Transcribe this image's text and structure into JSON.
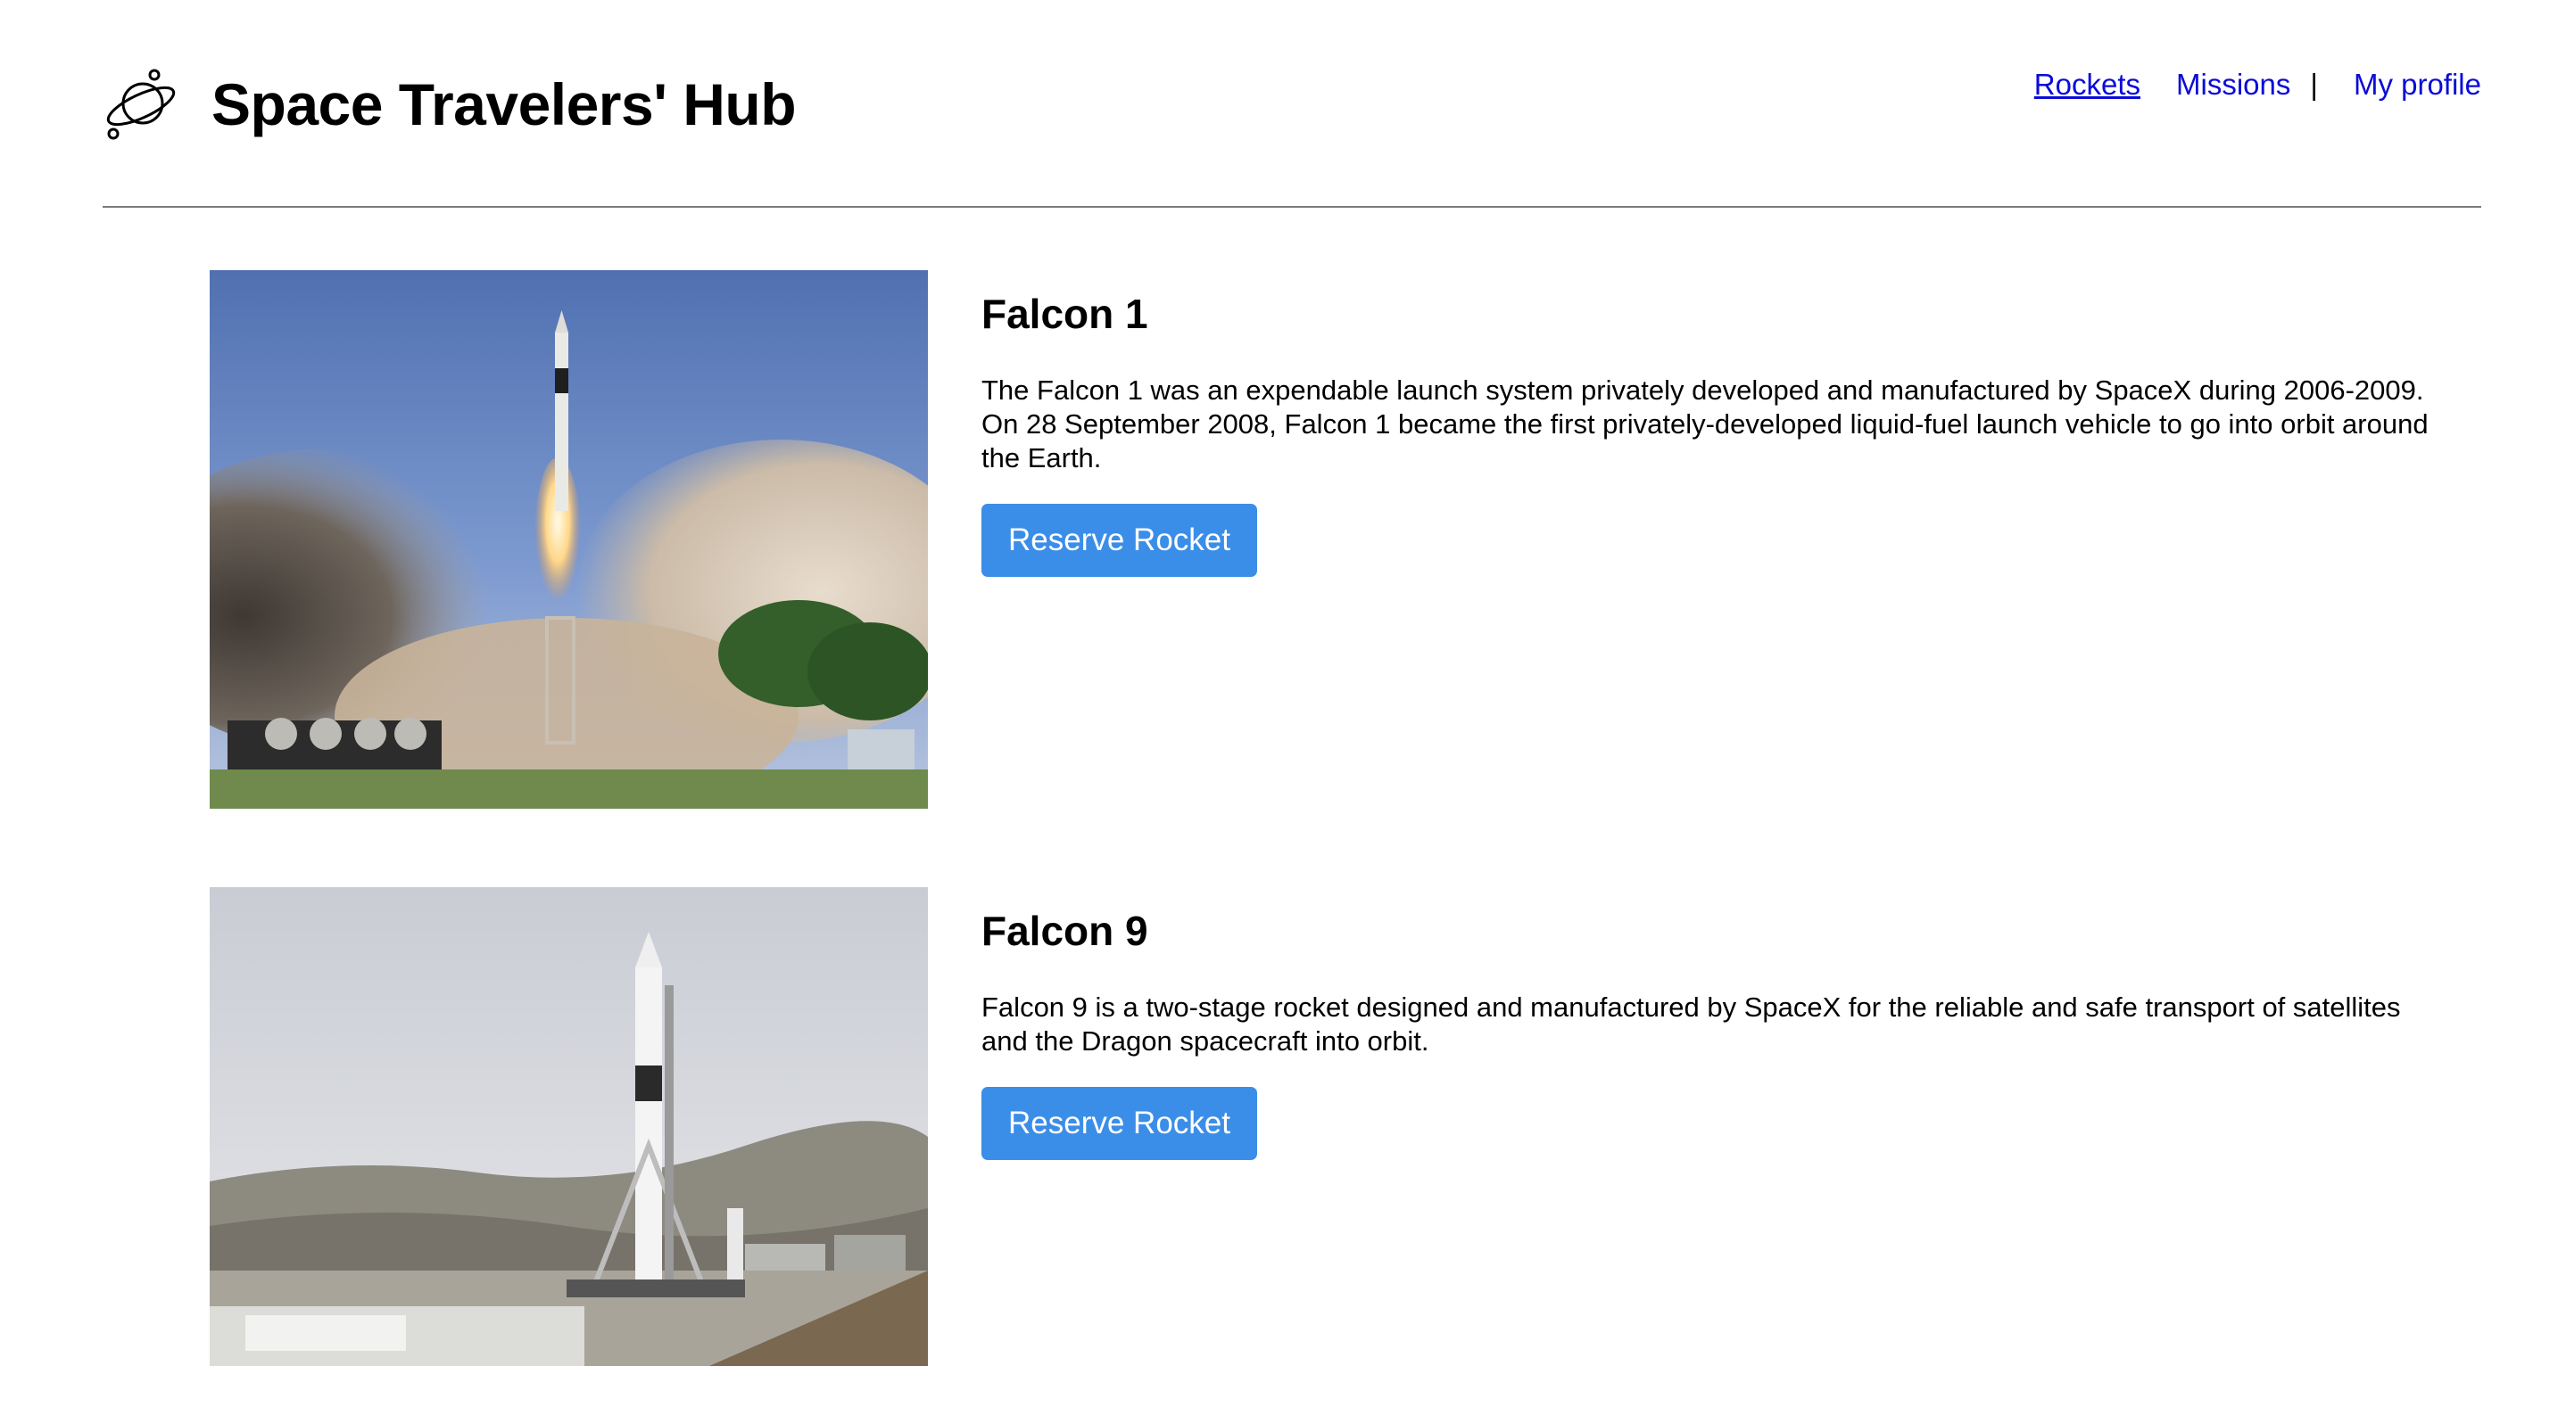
{
  "header": {
    "title": "Space Travelers' Hub",
    "logo_icon": "planet-icon"
  },
  "nav": {
    "rockets": "Rockets",
    "missions": "Missions",
    "separator": "|",
    "profile": "My profile",
    "active": "rockets"
  },
  "rockets": [
    {
      "name": "Falcon 1",
      "description": "The Falcon 1 was an expendable launch system privately developed and manufactured by SpaceX during 2006-2009. On 28 September 2008, Falcon 1 became the first privately-developed liquid-fuel launch vehicle to go into orbit around the Earth.",
      "button": "Reserve Rocket",
      "image": "rocket-launch-photo"
    },
    {
      "name": "Falcon 9",
      "description": "Falcon 9 is a two-stage rocket designed and manufactured by SpaceX for the reliable and safe transport of satellites and the Dragon spacecraft into orbit.",
      "button": "Reserve Rocket",
      "image": "rocket-on-pad-photo"
    }
  ],
  "colors": {
    "link": "#0b0bd8",
    "button": "#3b8ee8",
    "divider": "#7a7a7a"
  }
}
